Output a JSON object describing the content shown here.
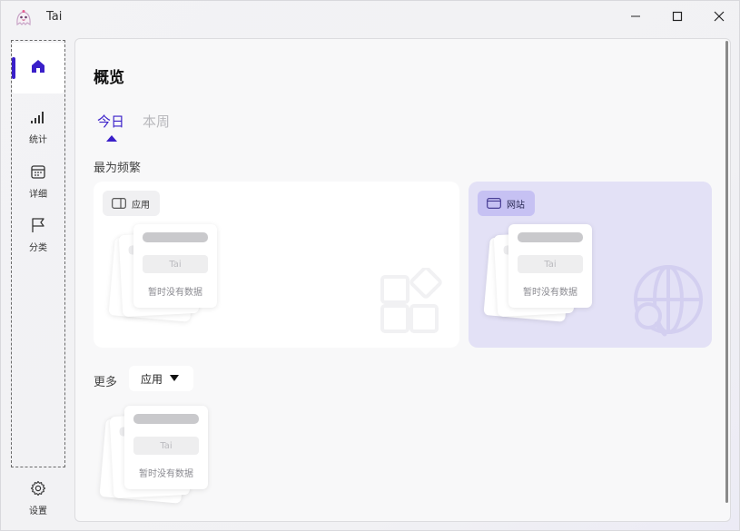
{
  "app": {
    "title": "Tai"
  },
  "window_controls": {
    "minimize": "minimize-icon",
    "maximize": "maximize-icon",
    "close": "close-icon"
  },
  "sidebar": {
    "items": [
      {
        "icon": "home-icon",
        "label": "",
        "active": true
      },
      {
        "icon": "stats-icon",
        "label": "统计"
      },
      {
        "icon": "calendar-icon",
        "label": "详细"
      },
      {
        "icon": "flag-icon",
        "label": "分类"
      }
    ],
    "settings": {
      "icon": "gear-icon",
      "label": "设置"
    }
  },
  "main": {
    "title": "概览",
    "tabs": [
      {
        "label": "今日",
        "active": true
      },
      {
        "label": "本周",
        "active": false
      }
    ],
    "most_frequent": {
      "title": "最为频繁",
      "cards": [
        {
          "chip": "应用",
          "icon": "app-icon",
          "empty_name": "Tai",
          "empty_text": "暂时没有数据"
        },
        {
          "chip": "网站",
          "icon": "website-icon",
          "empty_name": "Tai",
          "empty_text": "暂时没有数据"
        }
      ]
    },
    "more": {
      "label": "更多",
      "select_value": "应用",
      "empty_name": "Tai",
      "empty_text": "暂时没有数据"
    }
  },
  "colors": {
    "accent": "#3a1fc9",
    "website_card": "#e3e1f6",
    "website_chip": "#c6c1f3"
  }
}
